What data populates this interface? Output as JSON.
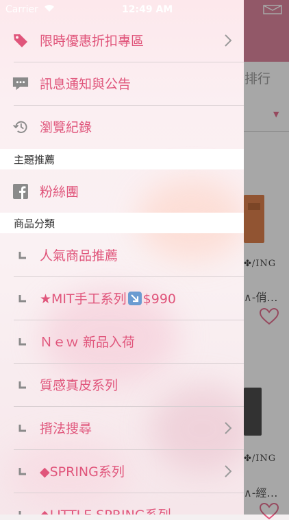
{
  "status_bar": {
    "carrier": "Carrier",
    "time": "12:49 AM"
  },
  "background": {
    "tab_label": "排行",
    "products": [
      {
        "brand": "✤/ING",
        "name": "∧-俏…"
      },
      {
        "brand": "✤/ING",
        "name": "∧-經…"
      }
    ]
  },
  "drawer": {
    "top_items": [
      {
        "label": "限時優惠折扣專區",
        "icon": "tag-icon",
        "chevron": true
      },
      {
        "label": "訊息通知與公告",
        "icon": "message-icon",
        "chevron": false
      },
      {
        "label": "瀏覽紀錄",
        "icon": "history-icon",
        "chevron": false
      }
    ],
    "section_theme": "主題推薦",
    "theme_items": [
      {
        "label": "粉絲團",
        "icon": "facebook-icon"
      }
    ],
    "section_category": "商品分類",
    "category_items": [
      {
        "label": "人氣商品推薦",
        "chevron": false
      },
      {
        "label_pre": "★MIT手工系列",
        "label_post": "$990",
        "chevron": false
      },
      {
        "label": "Ｎｅｗ 新品入荷",
        "chevron": false
      },
      {
        "label": "質感真皮系列",
        "chevron": false
      },
      {
        "label": "揹法搜尋",
        "chevron": true
      },
      {
        "label": "◆SPRING系列",
        "chevron": true
      },
      {
        "label": "◆LITTLE SPRING系列",
        "chevron": false
      }
    ]
  },
  "colors": {
    "accent": "#e0557b",
    "header": "#d9708c"
  }
}
